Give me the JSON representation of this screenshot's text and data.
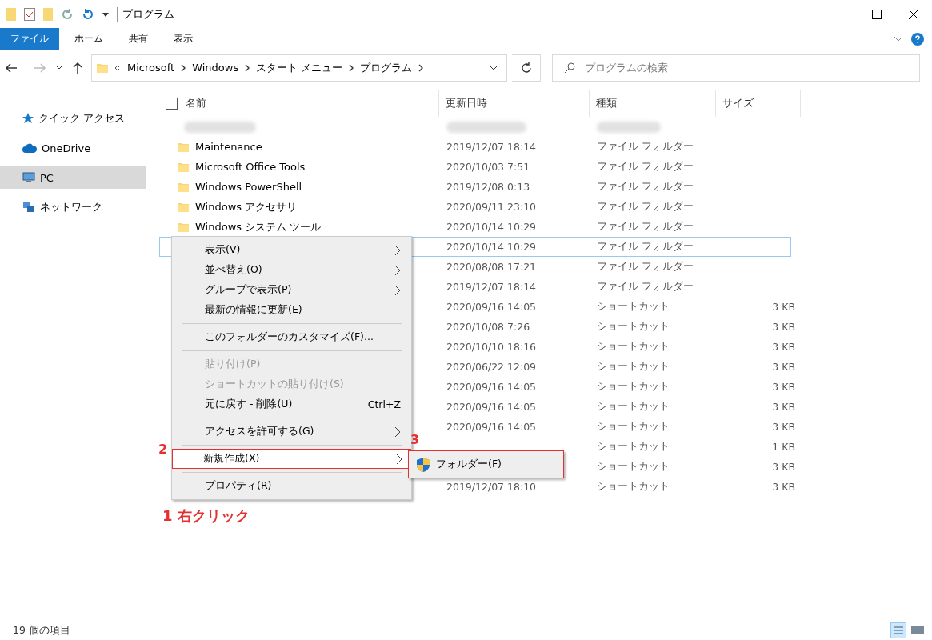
{
  "window": {
    "title": "プログラム"
  },
  "ribbon_tabs": [
    {
      "label": "ファイル",
      "selected": true
    },
    {
      "label": "ホーム",
      "selected": false
    },
    {
      "label": "共有",
      "selected": false
    },
    {
      "label": "表示",
      "selected": false
    }
  ],
  "address": {
    "crumbs": [
      "Microsoft",
      "Windows",
      "スタート メニュー",
      "プログラム"
    ]
  },
  "search": {
    "placeholder": "プログラムの検索"
  },
  "sidebar": {
    "items": [
      {
        "label": "クイック アクセス",
        "kind": "star",
        "selected": false
      },
      {
        "label": "OneDrive",
        "kind": "cloud",
        "selected": false
      },
      {
        "label": "PC",
        "kind": "pc",
        "selected": true
      },
      {
        "label": "ネットワーク",
        "kind": "network",
        "selected": false
      }
    ]
  },
  "table": {
    "select_all": {
      "checked": false
    },
    "columns": [
      "名前",
      "更新日時",
      "種類",
      "サイズ"
    ],
    "rows": [
      {
        "kind": "redacted",
        "selected": false
      },
      {
        "kind": "folder",
        "name": "Maintenance",
        "date": "2019/12/07 18:14",
        "type": "ファイル フォルダー",
        "selected": false
      },
      {
        "kind": "folder",
        "name": "Microsoft Office Tools",
        "date": "2020/10/03 7:51",
        "type": "ファイル フォルダー",
        "selected": false
      },
      {
        "kind": "folder",
        "name": "Windows PowerShell",
        "date": "2019/12/08 0:13",
        "type": "ファイル フォルダー",
        "selected": false
      },
      {
        "kind": "folder",
        "name": "Windows アクセサリ",
        "date": "2020/09/11 23:10",
        "type": "ファイル フォルダー",
        "selected": false
      },
      {
        "kind": "folder",
        "name": "Windows システム ツール",
        "date": "2020/10/14 10:29",
        "type": "ファイル フォルダー",
        "selected": false
      },
      {
        "kind": "hidden",
        "date": "2020/10/14 10:29",
        "type": "ファイル フォルダー",
        "selected": true
      },
      {
        "kind": "hidden",
        "date": "2020/08/08 17:21",
        "type": "ファイル フォルダー",
        "selected": false
      },
      {
        "kind": "hidden",
        "date": "2019/12/07 18:14",
        "type": "ファイル フォルダー",
        "selected": false
      },
      {
        "kind": "hidden",
        "date": "2020/09/16 14:05",
        "type": "ショートカット",
        "size": "3 KB",
        "selected": false
      },
      {
        "kind": "hidden",
        "date": "2020/10/08 7:26",
        "type": "ショートカット",
        "size": "3 KB",
        "selected": false
      },
      {
        "kind": "hidden",
        "date": "2020/10/10 18:16",
        "type": "ショートカット",
        "size": "3 KB",
        "selected": false
      },
      {
        "kind": "hidden",
        "date": "2020/06/22 12:09",
        "type": "ショートカット",
        "size": "3 KB",
        "selected": false
      },
      {
        "kind": "hidden",
        "date": "2020/09/16 14:05",
        "type": "ショートカット",
        "size": "3 KB",
        "selected": false
      },
      {
        "kind": "hidden",
        "date": "2020/09/16 14:05",
        "type": "ショートカット",
        "size": "3 KB",
        "selected": false
      },
      {
        "kind": "hidden",
        "date": "2020/09/16 14:05",
        "type": "ショートカット",
        "size": "3 KB",
        "selected": false
      },
      {
        "kind": "hidden",
        "type": "ショートカット",
        "size": "1 KB",
        "selected": false
      },
      {
        "kind": "hidden",
        "type": "ショートカット",
        "size": "3 KB",
        "selected": false
      },
      {
        "kind": "hidden",
        "date": "2019/12/07 18:10",
        "type": "ショートカット",
        "size": "3 KB",
        "selected": false
      }
    ]
  },
  "context_menu": [
    {
      "kind": "item",
      "label": "表示(V)",
      "submenu": true,
      "disabled": false
    },
    {
      "kind": "item",
      "label": "並べ替え(O)",
      "submenu": true,
      "disabled": false
    },
    {
      "kind": "item",
      "label": "グループで表示(P)",
      "submenu": true,
      "disabled": false
    },
    {
      "kind": "item",
      "label": "最新の情報に更新(E)",
      "submenu": false,
      "disabled": false
    },
    {
      "kind": "separator"
    },
    {
      "kind": "item",
      "label": "このフォルダーのカスタマイズ(F)...",
      "submenu": false,
      "disabled": false
    },
    {
      "kind": "separator"
    },
    {
      "kind": "item",
      "label": "貼り付け(P)",
      "submenu": false,
      "disabled": true
    },
    {
      "kind": "item",
      "label": "ショートカットの貼り付け(S)",
      "submenu": false,
      "disabled": true
    },
    {
      "kind": "item",
      "label": "元に戻す - 削除(U)",
      "shortcut": "Ctrl+Z",
      "submenu": false,
      "disabled": false
    },
    {
      "kind": "separator"
    },
    {
      "kind": "item",
      "label": "アクセスを許可する(G)",
      "submenu": true,
      "disabled": false
    },
    {
      "kind": "separator"
    },
    {
      "kind": "item",
      "label": "新規作成(X)",
      "submenu": true,
      "disabled": false,
      "step": "2"
    },
    {
      "kind": "separator"
    },
    {
      "kind": "item",
      "label": "プロパティ(R)",
      "submenu": false,
      "disabled": false
    }
  ],
  "submenu": {
    "label": "フォルダー(F)",
    "step": "3"
  },
  "annotation": {
    "step": "1",
    "label": "右クリック"
  },
  "status_bar": {
    "count": "19 個の項目"
  }
}
